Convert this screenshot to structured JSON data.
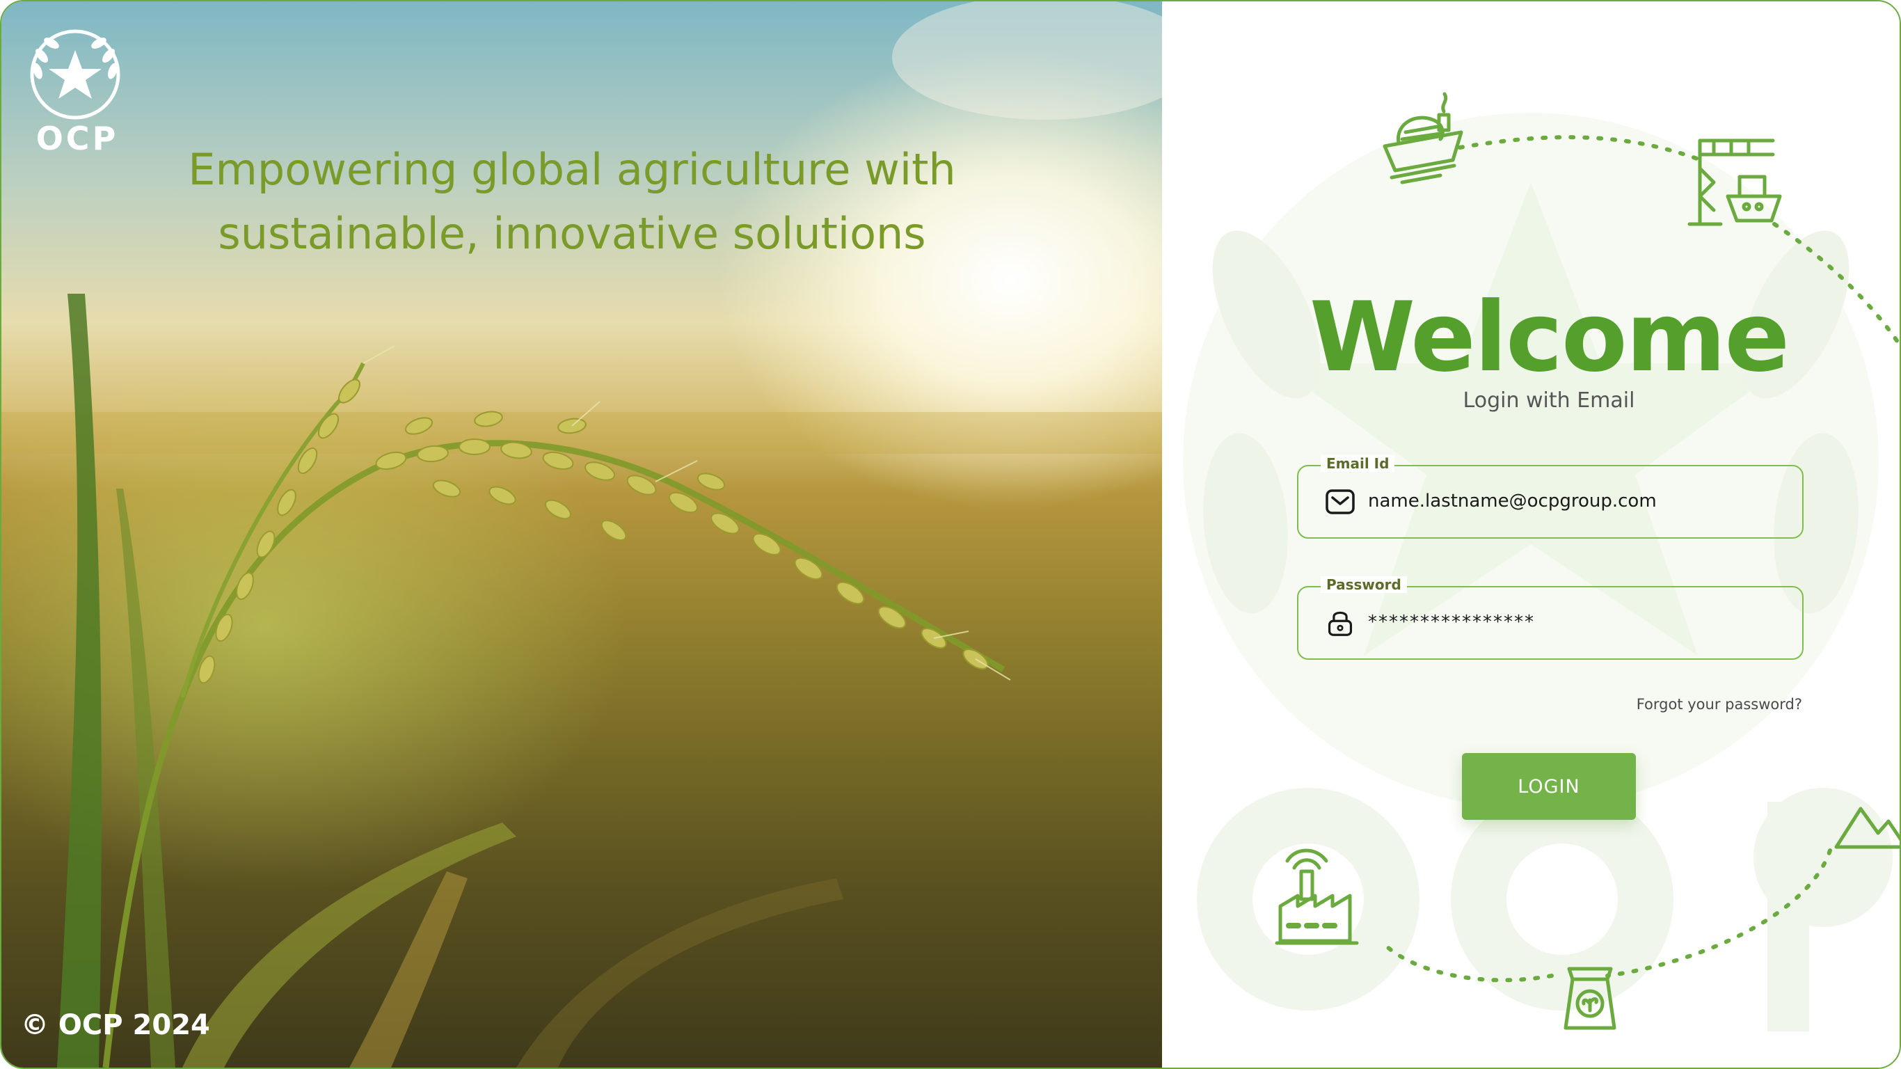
{
  "brand": {
    "logo_text": "OCP",
    "logo_icon": "ocp-star-wreath-icon"
  },
  "hero": {
    "tagline_line1": "Empowering global agriculture with",
    "tagline_line2": "sustainable, innovative solutions",
    "copyright": "© OCP 2024"
  },
  "login": {
    "title": "Welcome",
    "subtitle": "Login with Email",
    "email_label": "Email Id",
    "email_value": "name.lastname@ocpgroup.com",
    "password_label": "Password",
    "password_value": "****************",
    "forgot_label": "Forgot your password?",
    "login_label": "LOGIN"
  },
  "icons": {
    "email": "mail-icon",
    "password": "lock-icon",
    "decor": [
      "cargo-ship-icon",
      "port-crane-icon",
      "mountain-icon",
      "fertilizer-bag-icon",
      "factory-icon"
    ]
  },
  "colors": {
    "brand_green": "#55a02c",
    "button_green": "#74b34a",
    "border_green": "#7fbe4e"
  }
}
